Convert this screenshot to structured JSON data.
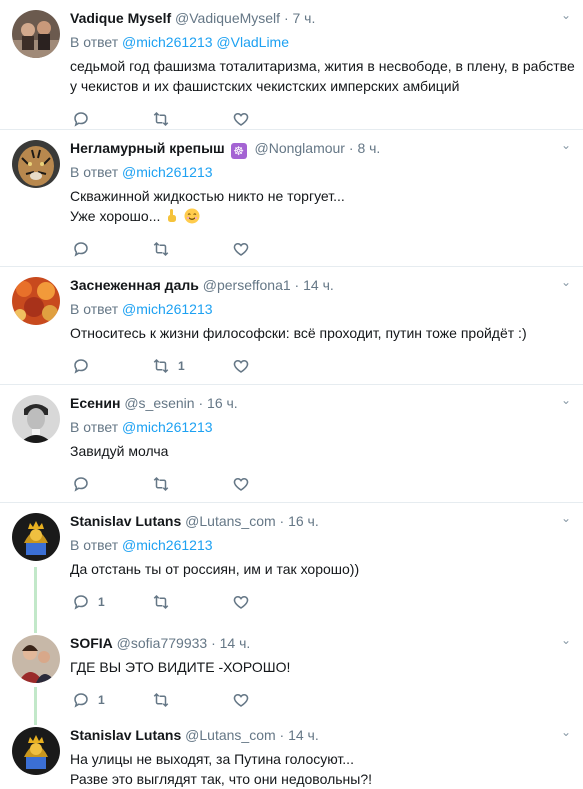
{
  "reply_prefix": "В ответ",
  "tweets": [
    {
      "name": "Vadique Myself",
      "handle": "@VadiqueMyself",
      "time": "7 ч.",
      "reply_to": [
        "@mich261213",
        "@VladLime"
      ],
      "lines": [
        "седьмой год фашизма тоталитаризма, жития в несвободе, в плену, в рабстве",
        "у чекистов и их фашистских чекистских имперских амбиций"
      ],
      "retweets": "",
      "replies": ""
    },
    {
      "name": "Негламурный крепыш",
      "badge": "☸",
      "handle": "@Nonglamour",
      "time": "8 ч.",
      "reply_to": [
        "@mich261213"
      ],
      "lines": [
        "Скважинной жидкостью никто не торгует...",
        "Уже хорошо..."
      ],
      "retweets": "",
      "replies": ""
    },
    {
      "name": "Заснеженная даль",
      "handle": "@perseffona1",
      "time": "14 ч.",
      "reply_to": [
        "@mich261213"
      ],
      "lines": [
        "Относитесь к жизни философски: всё проходит, путин тоже пройдёт :)"
      ],
      "retweets": "1",
      "replies": ""
    },
    {
      "name": "Есенин",
      "handle": "@s_esenin",
      "time": "16 ч.",
      "reply_to": [
        "@mich261213"
      ],
      "lines": [
        "Завидуй молча"
      ],
      "retweets": "",
      "replies": ""
    },
    {
      "name": "Stanislav Lutans",
      "handle": "@Lutans_com",
      "time": "16 ч.",
      "reply_to": [
        "@mich261213"
      ],
      "lines": [
        "Да отстань ты от россиян, им и так хорошо))"
      ],
      "retweets": "",
      "replies": "1"
    },
    {
      "name": "SOFIA",
      "handle": "@sofia779933",
      "time": "14 ч.",
      "reply_to": [],
      "lines": [
        "ГДЕ ВЫ ЭТО ВИДИТЕ -ХОРОШО!"
      ],
      "retweets": "",
      "replies": "1"
    },
    {
      "name": "Stanislav Lutans",
      "handle": "@Lutans_com",
      "time": "14 ч.",
      "reply_to": [],
      "lines": [
        "На улицы не выходят, за Путина голосуют...",
        "Разве это выглядят так, что они недовольны?!"
      ],
      "retweets": "",
      "replies": ""
    }
  ]
}
